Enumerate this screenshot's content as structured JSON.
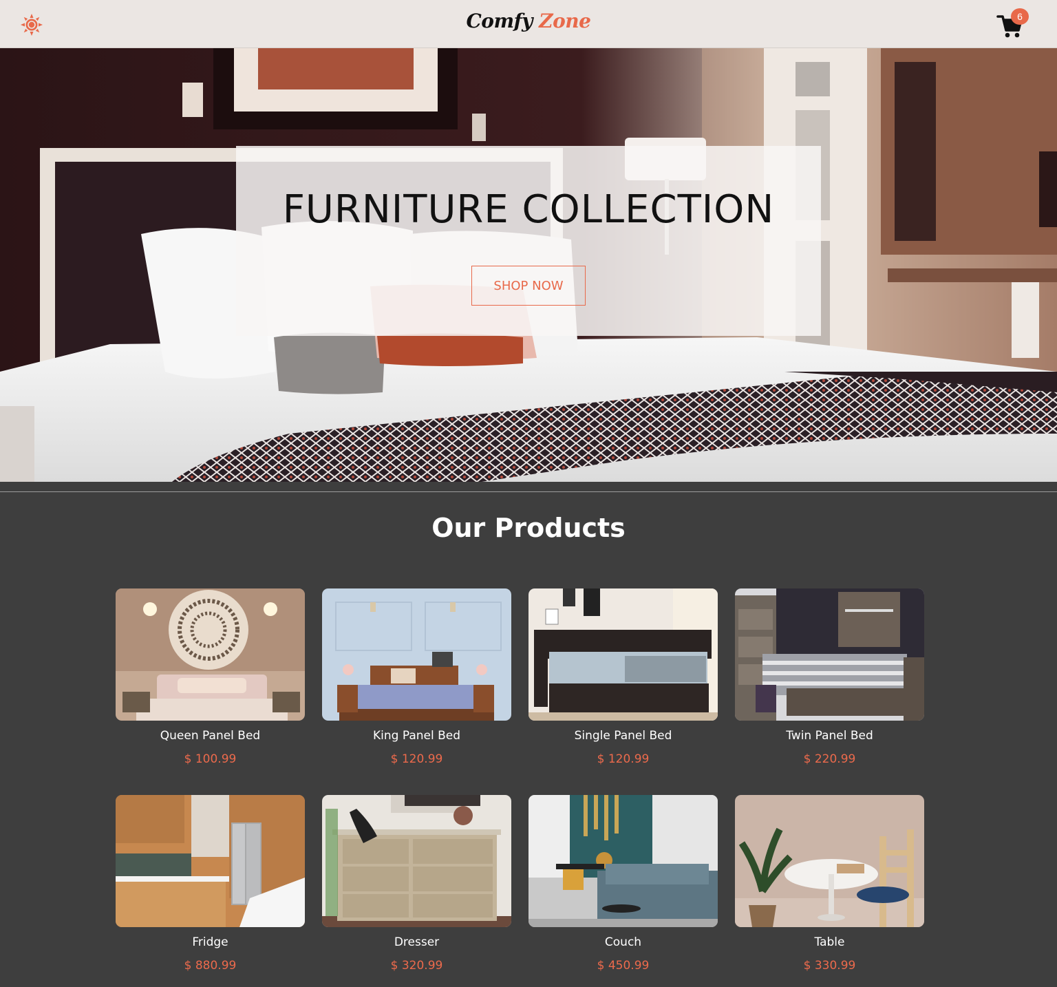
{
  "navbar": {
    "logo_part1": "Comfy",
    "logo_part2": "Zone",
    "cart_count": "6",
    "theme_icon": "sun-icon",
    "cart_icon": "cart-icon"
  },
  "hero": {
    "title": "FURNITURE COLLECTION",
    "button_label": "SHOP NOW"
  },
  "products": {
    "title": "Our Products",
    "items": [
      {
        "name": "Queen Panel Bed",
        "price": "$ 100.99"
      },
      {
        "name": "King Panel Bed",
        "price": "$ 120.99"
      },
      {
        "name": "Single Panel Bed",
        "price": "$ 120.99"
      },
      {
        "name": "Twin Panel Bed",
        "price": "$ 220.99"
      },
      {
        "name": "Fridge",
        "price": "$ 880.99"
      },
      {
        "name": "Dresser",
        "price": "$ 320.99"
      },
      {
        "name": "Couch",
        "price": "$ 450.99"
      },
      {
        "name": "Table",
        "price": "$ 330.99"
      }
    ]
  },
  "colors": {
    "accent": "#e8694a",
    "navbar_bg": "#ebe6e3",
    "page_bg": "#3e3e3e"
  }
}
